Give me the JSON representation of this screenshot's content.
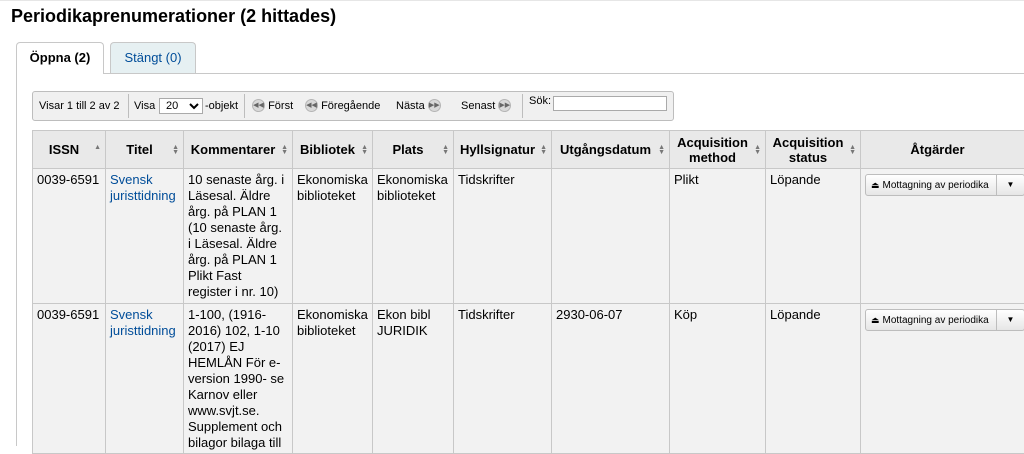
{
  "page": {
    "title": "Periodikaprenumerationer (2 hittades)"
  },
  "tabs": [
    {
      "label": "Öppna (2)",
      "active": true
    },
    {
      "label": "Stängt (0)",
      "active": false
    }
  ],
  "pager": {
    "info": "Visar 1 till 2 av 2",
    "show_label": "Visa",
    "page_size": "20",
    "objects_label": "-objekt",
    "first": "Först",
    "previous": "Föregående",
    "next": "Nästa",
    "last": "Senast",
    "search_label": "Sök:",
    "search_value": ""
  },
  "table": {
    "headers": {
      "issn": "ISSN",
      "title": "Titel",
      "comments": "Kommentarer",
      "library": "Bibliotek",
      "location": "Plats",
      "callnumber": "Hyllsignatur",
      "expiration": "Utgångsdatum",
      "acq_method_1": "Acquisition",
      "acq_method_2": "method",
      "acq_status_1": "Acquisition",
      "acq_status_2": "status",
      "actions": "Åtgärder"
    },
    "rows": [
      {
        "issn": "0039-6591",
        "title": "Svensk juristtidning",
        "comments": "10 senaste årg. i Läsesal. Äldre årg. på PLAN 1 (10 senaste årg. i Läsesal. Äldre årg. på PLAN 1 Plikt Fast register i nr. 10)",
        "library": "Ekonomiska biblioteket",
        "location": "Ekonomiska biblioteket",
        "callnumber": "Tidskrifter",
        "expiration": "",
        "acq_method": "Plikt",
        "acq_status": "Löpande",
        "action_label": "Mottagning av periodika"
      },
      {
        "issn": "0039-6591",
        "title": "Svensk juristtidning",
        "comments": "1-100, (1916-2016) 102, 1-10 (2017) EJ HEMLÅN För e- version 1990- se Karnov eller www.svjt.se. Supplement och bilagor bilaga till",
        "library": "Ekonomiska biblioteket",
        "location": "Ekon bibl JURIDIK",
        "callnumber": "Tidskrifter",
        "expiration": "2930-06-07",
        "acq_method": "Köp",
        "acq_status": "Löpande",
        "action_label": "Mottagning av periodika"
      }
    ]
  }
}
